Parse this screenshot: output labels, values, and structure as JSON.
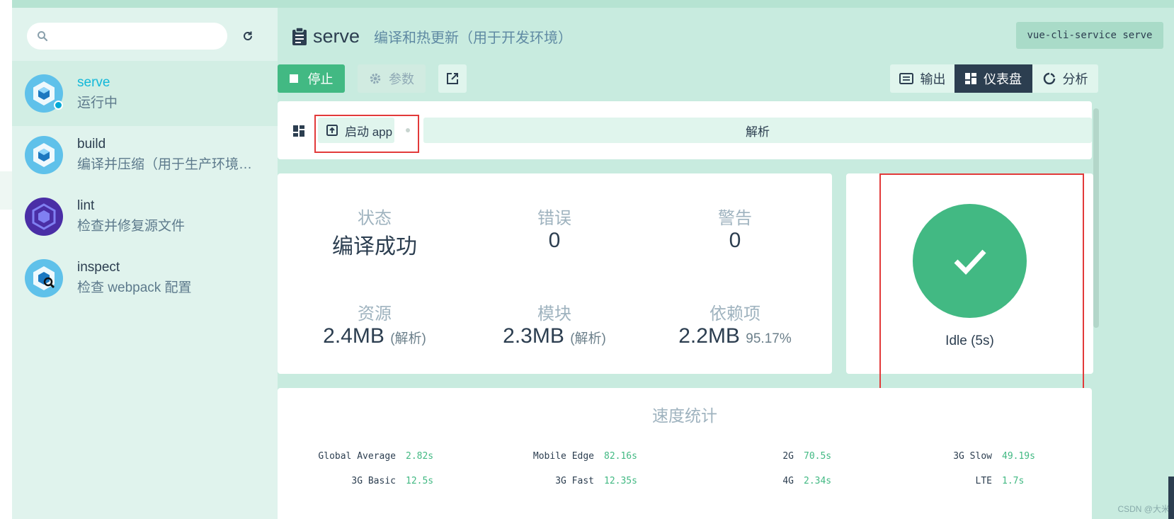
{
  "sidebar": {
    "search": {
      "placeholder": "",
      "value": ""
    },
    "tasks": [
      {
        "name": "serve",
        "description": "运行中",
        "icon": "webpack-cube-icon",
        "status": "running"
      },
      {
        "name": "build",
        "description": "编译并压缩（用于生产环境…",
        "icon": "webpack-cube-icon"
      },
      {
        "name": "lint",
        "description": "检查并修复源文件",
        "icon": "eslint-hexagon-icon"
      },
      {
        "name": "inspect",
        "description": "检查 webpack 配置",
        "icon": "webpack-inspect-icon"
      }
    ]
  },
  "header": {
    "title": "serve",
    "description": "编译和热更新（用于开发环境）",
    "command": "vue-cli-service serve"
  },
  "actions": {
    "stop": "停止",
    "params": "参数"
  },
  "view_tabs": [
    {
      "label": "输出",
      "icon": "terminal-icon"
    },
    {
      "label": "仪表盘",
      "icon": "dashboard-icon",
      "active": true
    },
    {
      "label": "分析",
      "icon": "analyzer-icon"
    }
  ],
  "toolbar": {
    "launch": "启动 app",
    "analyze": "解析"
  },
  "stats": {
    "status": {
      "label": "状态",
      "value": "编译成功"
    },
    "errors": {
      "label": "错误",
      "value": "0"
    },
    "warnings": {
      "label": "警告",
      "value": "0"
    },
    "assets": {
      "label": "资源",
      "value": "2.4MB",
      "note": "(解析)"
    },
    "modules": {
      "label": "模块",
      "value": "2.3MB",
      "note": "(解析)"
    },
    "dependencies": {
      "label": "依赖项",
      "value": "2.2MB",
      "note": "95.17%"
    }
  },
  "status_card": {
    "text": "Idle (5s)",
    "color": "#42b983"
  },
  "speed": {
    "title": "速度统计",
    "rows": [
      [
        {
          "label": "Global Average",
          "value": "2.82s"
        },
        {
          "label": "Mobile Edge",
          "value": "82.16s"
        },
        {
          "label": "2G",
          "value": "70.5s"
        },
        {
          "label": "3G Slow",
          "value": "49.19s"
        }
      ],
      [
        {
          "label": "3G Basic",
          "value": "12.5s"
        },
        {
          "label": "3G Fast",
          "value": "12.35s"
        },
        {
          "label": "4G",
          "value": "2.34s"
        },
        {
          "label": "LTE",
          "value": "1.7s"
        }
      ]
    ]
  },
  "watermark": "CSDN @大米"
}
